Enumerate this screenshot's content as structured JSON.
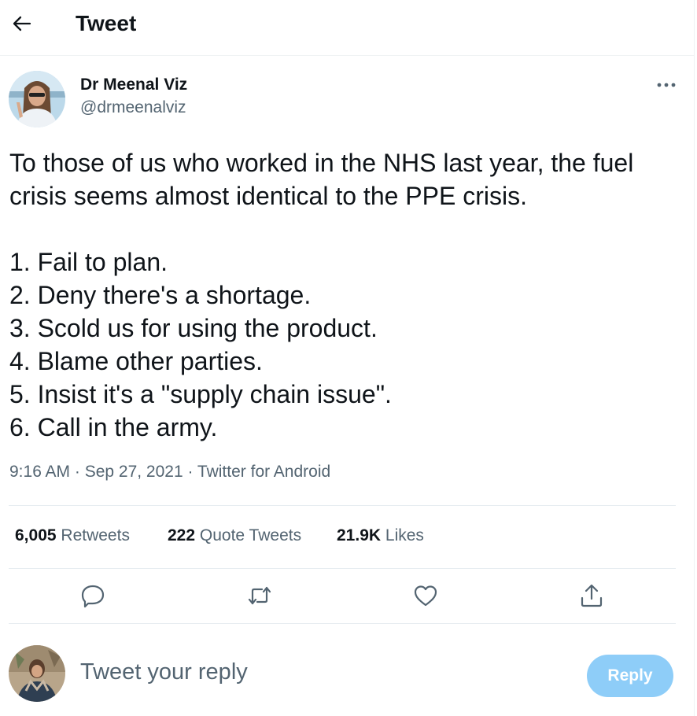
{
  "header": {
    "title": "Tweet"
  },
  "author": {
    "name": "Dr Meenal Viz",
    "handle": "@drmeenalviz"
  },
  "tweet": {
    "text": "To those of us who worked in the NHS last year, the fuel crisis seems almost identical to the PPE crisis.\n\n1. Fail to plan.\n2. Deny there's a shortage.\n3. Scold us for using the product.\n4. Blame other parties.\n5. Insist it's a \"supply chain issue\".\n6. Call in the army.",
    "meta": "9:16 AM · Sep 27, 2021 · Twitter for Android"
  },
  "stats": {
    "retweets_count": "6,005",
    "retweets_label": "Retweets",
    "quotes_count": "222",
    "quotes_label": "Quote Tweets",
    "likes_count": "21.9K",
    "likes_label": "Likes"
  },
  "reply": {
    "placeholder": "Tweet your reply",
    "button_label": "Reply"
  },
  "icons": {
    "back": "arrow-left-icon",
    "more": "more-horizontal-icon",
    "reply": "comment-icon",
    "retweet": "retweet-icon",
    "like": "heart-icon",
    "share": "share-icon"
  },
  "colors": {
    "text": "#0f1419",
    "secondary": "#536471",
    "accent_disabled": "#8ecdf8",
    "divider": "#e6ecf0"
  }
}
